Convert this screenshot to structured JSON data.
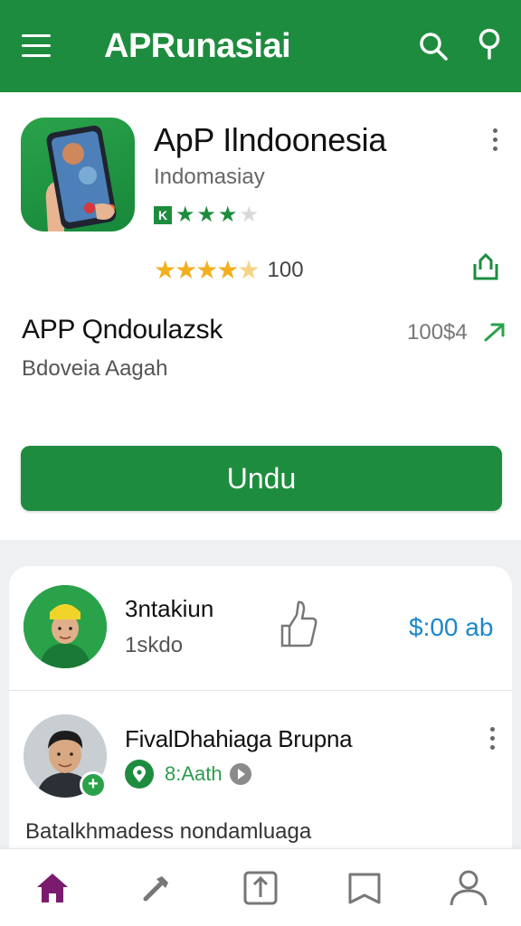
{
  "appbar": {
    "title": "APRunasiai",
    "icons": [
      "menu-icon",
      "search-icon",
      "location-pin-icon"
    ]
  },
  "app": {
    "name": "ApP Ilndoonesia",
    "developer": "Indomasiay",
    "small_rating_stars": 3,
    "small_rating_badge": "K",
    "rating_stars": 4.5,
    "rating_count": "100",
    "subtitle": "APP Qndoulazsk",
    "subtitle_developer": "Bdoveia Aagah",
    "subtitle_value": "100$4",
    "install_button": "Undu"
  },
  "reviews": [
    {
      "name": "3ntakiun",
      "meta": "1skdo",
      "price": "$:00 ab"
    },
    {
      "name": "FivalDhahiaga Brupna",
      "meta": "8:Aath",
      "body": "Batalkhmadess nondamluaga"
    }
  ],
  "bottom_nav": [
    "home-icon",
    "tools-icon",
    "upload-icon",
    "bookmark-icon",
    "profile-icon"
  ],
  "colors": {
    "primary_green": "#1e8c3e",
    "star_gold": "#f2b01e",
    "price_blue": "#1b87c9",
    "nav_active": "#7b1b6e"
  }
}
